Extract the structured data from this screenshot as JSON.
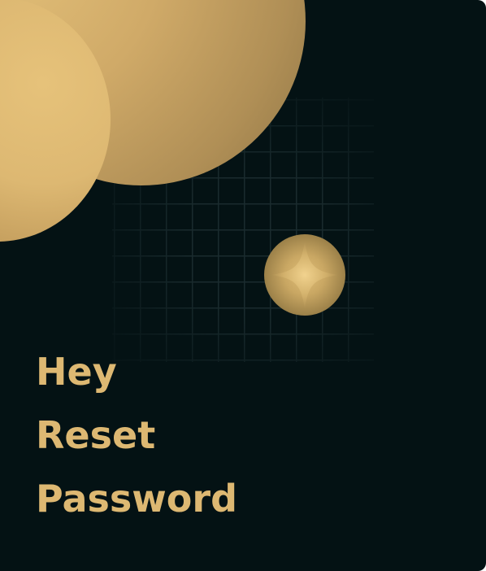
{
  "heading": {
    "lines": [
      "Hey",
      "Reset",
      "Password"
    ]
  },
  "colors": {
    "background": "#041214",
    "accent_gold": "#DDB872",
    "grid_line": "#1A2B2E"
  },
  "decor": {
    "shapes": [
      "large-gold-circle",
      "medium-gold-circle",
      "grid-pattern",
      "gold-orb"
    ]
  }
}
